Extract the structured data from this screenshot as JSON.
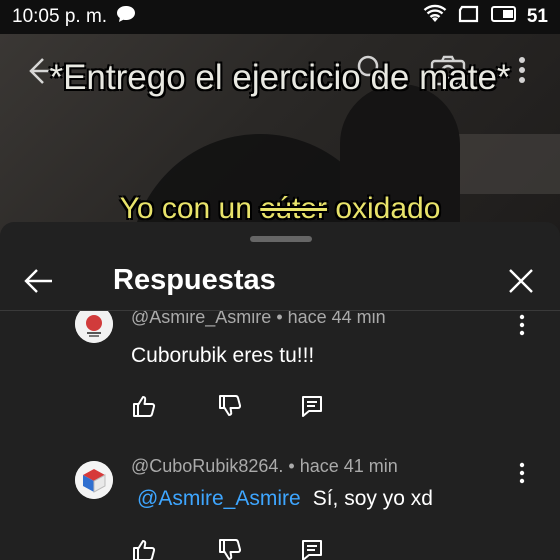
{
  "status_bar": {
    "time": "10:05 p. m.",
    "battery": "51"
  },
  "video": {
    "caption_top": "*Entrego el ejercicio de mate*",
    "caption_bottom_pre": "Yo con un",
    "caption_bottom_strike": "cúter",
    "caption_bottom_post": "oxidado"
  },
  "sheet": {
    "title": "Respuestas"
  },
  "comments": [
    {
      "author": "@Asmire_Asmire",
      "time": "hace 44 min",
      "text": "Cuborubik eres tu!!!",
      "mention": ""
    },
    {
      "author": "@CuboRubik8264.",
      "time": "hace 41 min",
      "mention": "@Asmire_Asmire",
      "text": "Sí, soy yo xd"
    }
  ],
  "icons": {
    "back": "arrow-left-icon",
    "close": "close-icon",
    "like": "thumb-up-icon",
    "dislike": "thumb-down-icon",
    "reply": "reply-icon",
    "more": "more-vert-icon"
  }
}
